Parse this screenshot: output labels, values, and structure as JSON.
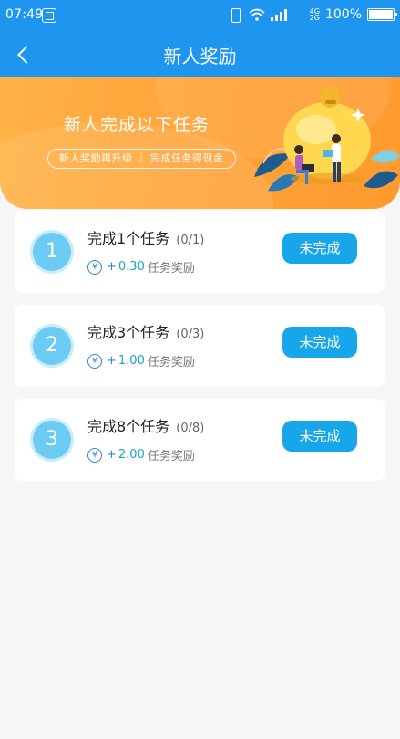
{
  "status_bar": {
    "time": "07:49",
    "network": [
      "4G",
      "2G"
    ],
    "battery": "100%"
  },
  "nav": {
    "title": "新人奖励"
  },
  "banner": {
    "title": "新人完成以下任务",
    "subtitle": "新人奖励再升级 ｜ 完成任务得现金"
  },
  "tasks": [
    {
      "number": "1",
      "title": "完成1个任务",
      "progress": "(0/1)",
      "currency": "¥",
      "plus": "+",
      "amount": "0.30",
      "reward_label": "任务奖励",
      "button": "未完成"
    },
    {
      "number": "2",
      "title": "完成3个任务",
      "progress": "(0/3)",
      "currency": "¥",
      "plus": "+",
      "amount": "1.00",
      "reward_label": "任务奖励",
      "button": "未完成"
    },
    {
      "number": "3",
      "title": "完成8个任务",
      "progress": "(0/8)",
      "currency": "¥",
      "plus": "+",
      "amount": "2.00",
      "reward_label": "任务奖励",
      "button": "未完成"
    }
  ],
  "colors": {
    "primary": "#1e96f0",
    "button": "#16a6e9",
    "banner": "#ffa43a",
    "number_circle": "#6ccbf3"
  }
}
